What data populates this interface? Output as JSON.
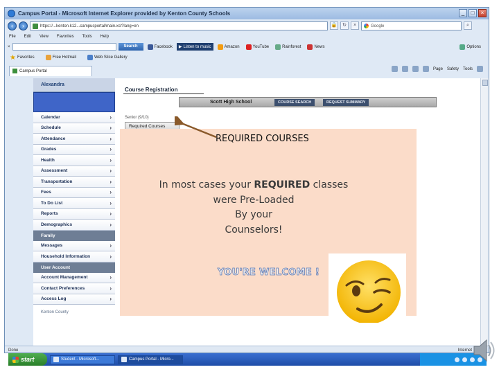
{
  "browser": {
    "title": "Campus Portal - Microsoft Internet Explorer provided by Kenton County Schools",
    "url": "https://...kenton.k12...campusportal/main.xsl?lang=en",
    "search_placeholder": "Google",
    "menu": [
      "File",
      "Edit",
      "View",
      "Favorites",
      "Tools",
      "Help"
    ],
    "toolbar_search_label": "Search",
    "toolbar_items": [
      "Facebook",
      "Listen to music",
      "Amazon",
      "YouTube",
      "Rainforest",
      "News",
      "Options"
    ],
    "favorites_label": "Favorites",
    "favorites_items": [
      "Free Hotmail",
      "Web Slice Gallery"
    ],
    "tab_label": "Campus Portal",
    "command_items": [
      "Page",
      "Safety",
      "Tools"
    ],
    "status_text": "Done",
    "status_zone": "Internet"
  },
  "page": {
    "student_name": "Alexandra",
    "course_registration_title": "Course Registration",
    "school_name": "Scott High School",
    "school_tabs": [
      "COURSE SEARCH",
      "REQUEST SUMMARY"
    ],
    "term_label": "Senior (9/10)",
    "required_tab": "Required Courses",
    "nav_items": [
      "Calendar",
      "Schedule",
      "Attendance",
      "Grades",
      "Health",
      "Assessment",
      "Transportation",
      "Fees",
      "To Do List",
      "Reports",
      "Demographics"
    ],
    "family_section": "Family",
    "family_items": [
      "Messages",
      "Household Information"
    ],
    "account_section": "User Account",
    "account_items": [
      "Account Management",
      "Contact Preferences",
      "Access Log"
    ],
    "district_link": "Kenton County"
  },
  "overlay": {
    "heading": "REQUIRED COURSES",
    "line1_pre": "In most cases your ",
    "line1_emph": "REQUIRED",
    "line1_post": " classes",
    "line2": "were Pre-Loaded",
    "line3": "By your",
    "line4": "Counselors!",
    "welcome": "YOU'RE WELCOME !",
    "emoji_icon": "winking-face-icon",
    "arrow_color": "#8a5a2b",
    "panel_color": "#fbdcc9"
  },
  "taskbar": {
    "start_label": "start",
    "tasks": [
      "Student - Microsoft...",
      "Campus Portal - Micro..."
    ]
  },
  "colors": {
    "sidebar_accent": "#3f65c8",
    "section_header": "#6e7e95",
    "taskbar": "#1f4ea8"
  }
}
